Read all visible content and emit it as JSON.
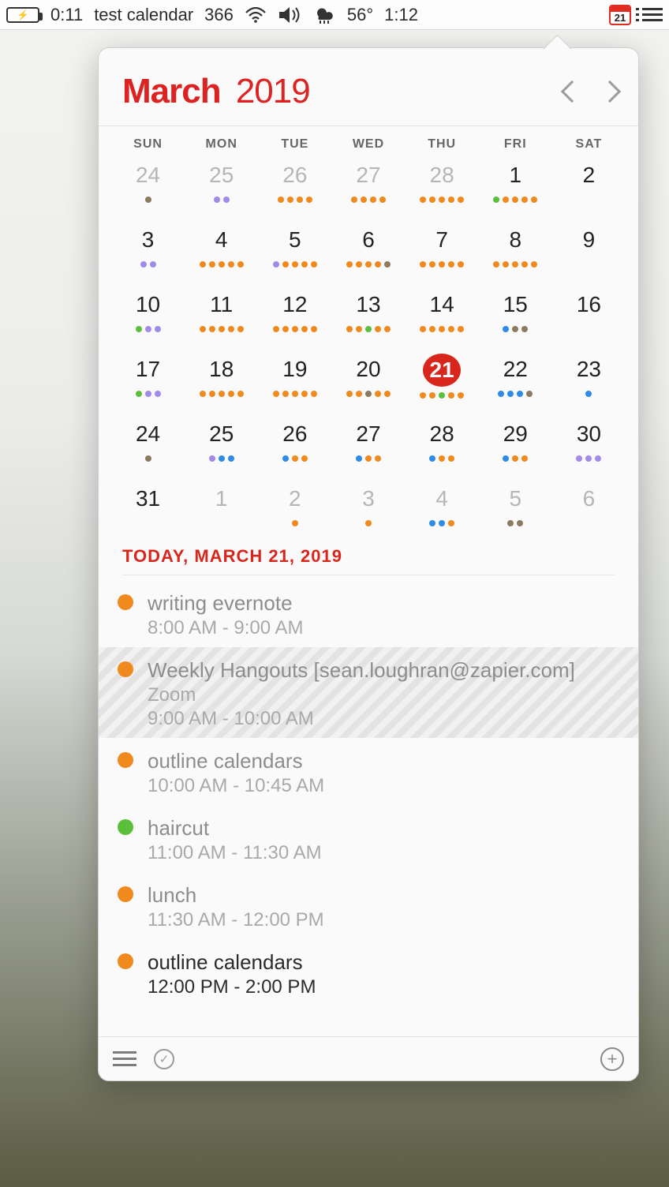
{
  "menubar": {
    "battery_time": "0:11",
    "notif_label": "test calendar",
    "badge": "366",
    "temp": "56°",
    "clock": "1:12",
    "cal_icon_day": "21"
  },
  "header": {
    "month": "March",
    "year": "2019"
  },
  "dow": [
    "SUN",
    "MON",
    "TUE",
    "WED",
    "THU",
    "FRI",
    "SAT"
  ],
  "days": [
    {
      "n": "24",
      "other": true,
      "dots": [
        "br"
      ]
    },
    {
      "n": "25",
      "other": true,
      "dots": [
        "p",
        "p"
      ]
    },
    {
      "n": "26",
      "other": true,
      "dots": [
        "o",
        "o",
        "o",
        "o"
      ]
    },
    {
      "n": "27",
      "other": true,
      "dots": [
        "o",
        "o",
        "o",
        "o"
      ]
    },
    {
      "n": "28",
      "other": true,
      "dots": [
        "o",
        "o",
        "o",
        "o",
        "o"
      ]
    },
    {
      "n": "1",
      "dots": [
        "g",
        "o",
        "o",
        "o",
        "o"
      ]
    },
    {
      "n": "2",
      "dots": []
    },
    {
      "n": "3",
      "dots": [
        "p",
        "p"
      ]
    },
    {
      "n": "4",
      "dots": [
        "o",
        "o",
        "o",
        "o",
        "o"
      ]
    },
    {
      "n": "5",
      "dots": [
        "p",
        "o",
        "o",
        "o",
        "o"
      ]
    },
    {
      "n": "6",
      "dots": [
        "o",
        "o",
        "o",
        "o",
        "br"
      ]
    },
    {
      "n": "7",
      "dots": [
        "o",
        "o",
        "o",
        "o",
        "o"
      ]
    },
    {
      "n": "8",
      "dots": [
        "o",
        "o",
        "o",
        "o",
        "o"
      ]
    },
    {
      "n": "9",
      "dots": []
    },
    {
      "n": "10",
      "dots": [
        "g",
        "p",
        "p"
      ]
    },
    {
      "n": "11",
      "dots": [
        "o",
        "o",
        "o",
        "o",
        "o"
      ]
    },
    {
      "n": "12",
      "dots": [
        "o",
        "o",
        "o",
        "o",
        "o"
      ]
    },
    {
      "n": "13",
      "dots": [
        "o",
        "o",
        "g",
        "o",
        "o"
      ]
    },
    {
      "n": "14",
      "dots": [
        "o",
        "o",
        "o",
        "o",
        "o"
      ]
    },
    {
      "n": "15",
      "dots": [
        "b",
        "br",
        "br"
      ]
    },
    {
      "n": "16",
      "dots": []
    },
    {
      "n": "17",
      "dots": [
        "g",
        "p",
        "p"
      ]
    },
    {
      "n": "18",
      "dots": [
        "o",
        "o",
        "o",
        "o",
        "o"
      ]
    },
    {
      "n": "19",
      "dots": [
        "o",
        "o",
        "o",
        "o",
        "o"
      ]
    },
    {
      "n": "20",
      "dots": [
        "o",
        "o",
        "br",
        "o",
        "o"
      ]
    },
    {
      "n": "21",
      "today": true,
      "dots": [
        "o",
        "o",
        "g",
        "o",
        "o"
      ]
    },
    {
      "n": "22",
      "dots": [
        "b",
        "b",
        "b",
        "br"
      ]
    },
    {
      "n": "23",
      "dots": [
        "b"
      ]
    },
    {
      "n": "24",
      "dots": [
        "br"
      ]
    },
    {
      "n": "25",
      "dots": [
        "p",
        "b",
        "b"
      ]
    },
    {
      "n": "26",
      "dots": [
        "b",
        "o",
        "o"
      ]
    },
    {
      "n": "27",
      "dots": [
        "b",
        "o",
        "o"
      ]
    },
    {
      "n": "28",
      "dots": [
        "b",
        "o",
        "o"
      ]
    },
    {
      "n": "29",
      "dots": [
        "b",
        "o",
        "o"
      ]
    },
    {
      "n": "30",
      "dots": [
        "p",
        "p",
        "p"
      ]
    },
    {
      "n": "31",
      "dots": []
    },
    {
      "n": "1",
      "other": true,
      "dots": []
    },
    {
      "n": "2",
      "other": true,
      "dots": [
        "o"
      ]
    },
    {
      "n": "3",
      "other": true,
      "dots": [
        "o"
      ]
    },
    {
      "n": "4",
      "other": true,
      "dots": [
        "b",
        "b",
        "o"
      ]
    },
    {
      "n": "5",
      "other": true,
      "dots": [
        "br",
        "br"
      ]
    },
    {
      "n": "6",
      "other": true,
      "dots": []
    }
  ],
  "today_header": "TODAY, MARCH 21, 2019",
  "events": [
    {
      "color": "o",
      "title": "writing evernote",
      "time": "8:00 AM - 9:00 AM"
    },
    {
      "color": "o",
      "striped": true,
      "title": "Weekly Hangouts [sean.loughran@zapier.com]",
      "sub": "Zoom",
      "time": "9:00 AM - 10:00 AM"
    },
    {
      "color": "o",
      "title": "outline calendars",
      "time": "10:00 AM - 10:45 AM"
    },
    {
      "color": "g",
      "title": "haircut",
      "time": "11:00 AM - 11:30 AM"
    },
    {
      "color": "o",
      "title": "lunch",
      "time": "11:30 AM - 12:00 PM"
    },
    {
      "color": "o",
      "current": true,
      "title": "outline calendars",
      "time": "12:00 PM - 2:00 PM"
    }
  ]
}
